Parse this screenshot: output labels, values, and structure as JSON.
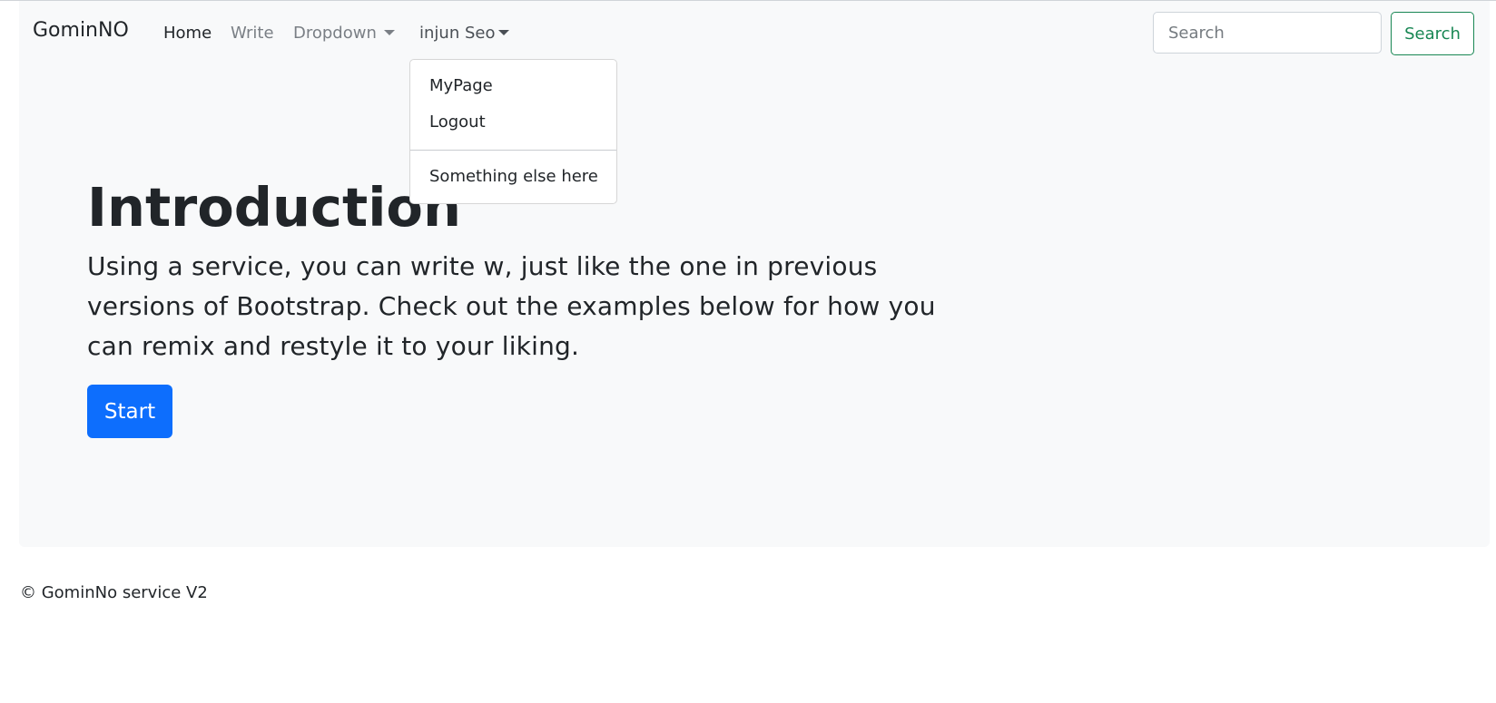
{
  "navbar": {
    "brand": "GominNO",
    "links": {
      "home": "Home",
      "write": "Write",
      "dropdown": "Dropdown",
      "user": "injun Seo"
    },
    "search": {
      "placeholder": "Search",
      "value": "",
      "button_label": "Search"
    }
  },
  "user_menu": {
    "items": [
      "MyPage",
      "Logout",
      "Something else here"
    ]
  },
  "hero": {
    "title": "Introduction",
    "text": "Using a service, you can write w, just like the one in previous versions of Bootstrap. Check out the examples below for how you can remix and restyle it to your liking.",
    "button_label": "Start"
  },
  "footer": {
    "text": "© GominNo service V2"
  },
  "colors": {
    "primary": "#0d6efd",
    "success": "#198754",
    "light_bg": "#f8f9fa",
    "text": "#212529"
  },
  "icons": [
    "caret-down-icon"
  ]
}
